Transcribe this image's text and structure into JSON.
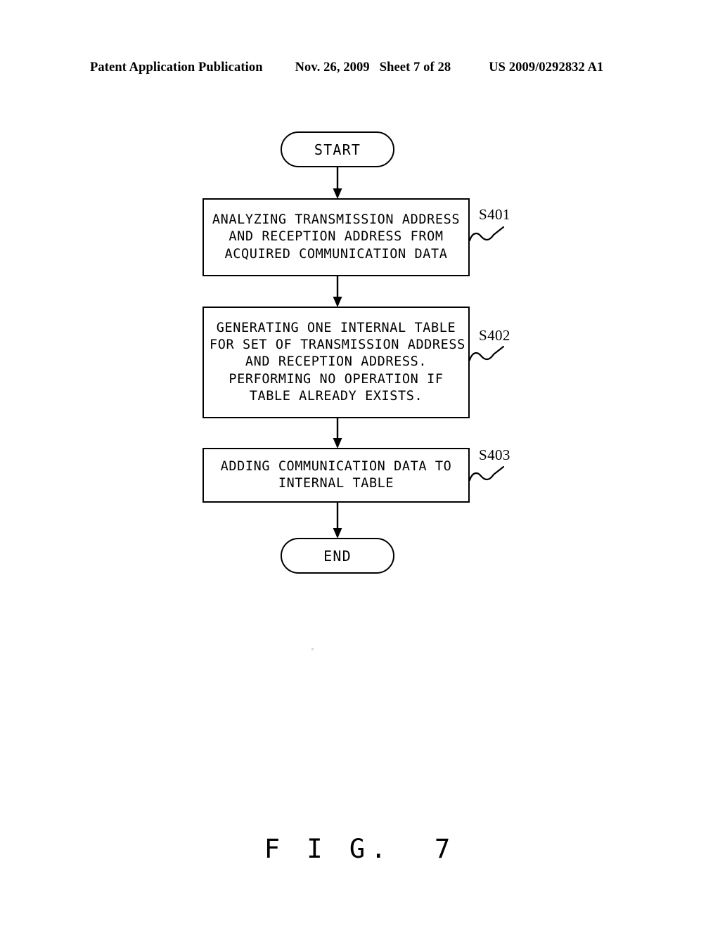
{
  "header": {
    "publication": "Patent Application Publication",
    "date": "Nov. 26, 2009",
    "sheet": "Sheet 7 of 28",
    "publication_number": "US 2009/0292832 A1"
  },
  "figure": {
    "caption": "F I G.  7"
  },
  "flowchart": {
    "start": {
      "label": "START"
    },
    "end": {
      "label": "END"
    },
    "steps": [
      {
        "ref": "S401",
        "lines": [
          "ANALYZING TRANSMISSION ADDRESS",
          "AND RECEPTION ADDRESS FROM",
          "ACQUIRED COMMUNICATION DATA"
        ]
      },
      {
        "ref": "S402",
        "lines": [
          "GENERATING ONE INTERNAL TABLE",
          "FOR SET OF TRANSMISSION ADDRESS",
          "AND RECEPTION ADDRESS.",
          "PERFORMING NO OPERATION IF",
          "TABLE ALREADY EXISTS."
        ]
      },
      {
        "ref": "S403",
        "lines": [
          "ADDING COMMUNICATION DATA TO",
          "INTERNAL TABLE"
        ]
      }
    ]
  },
  "colors": {
    "ink": "#000000",
    "paper": "#ffffff"
  }
}
